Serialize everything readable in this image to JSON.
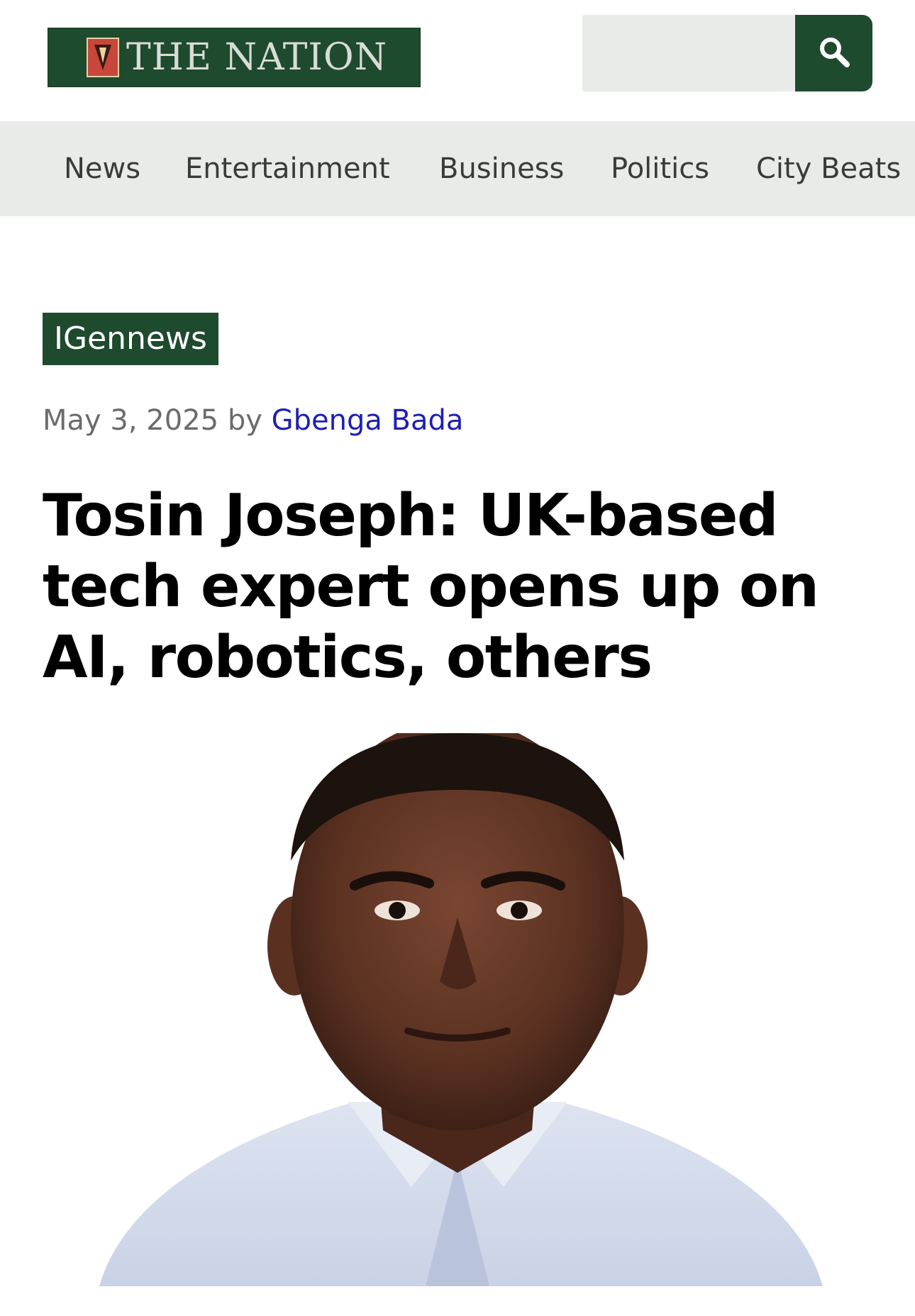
{
  "header": {
    "logo_text": "THE NATION",
    "search": {
      "placeholder": "",
      "value": "",
      "icon": "search-icon"
    }
  },
  "nav": {
    "items": [
      {
        "label": "News"
      },
      {
        "label": "Entertainment"
      },
      {
        "label": "Business"
      },
      {
        "label": "Politics"
      },
      {
        "label": "City Beats"
      }
    ]
  },
  "article": {
    "category": "IGennews",
    "date": "May 3, 2025",
    "by": "by",
    "author": "Gbenga Bada",
    "headline": "Tosin Joseph: UK-based tech expert opens up on AI, robotics, others"
  },
  "colors": {
    "brand_green": "#1e4a2e",
    "nav_background": "#e9ebe8",
    "author_link": "#1f1fb4",
    "meta_text": "#6b6b6b"
  }
}
